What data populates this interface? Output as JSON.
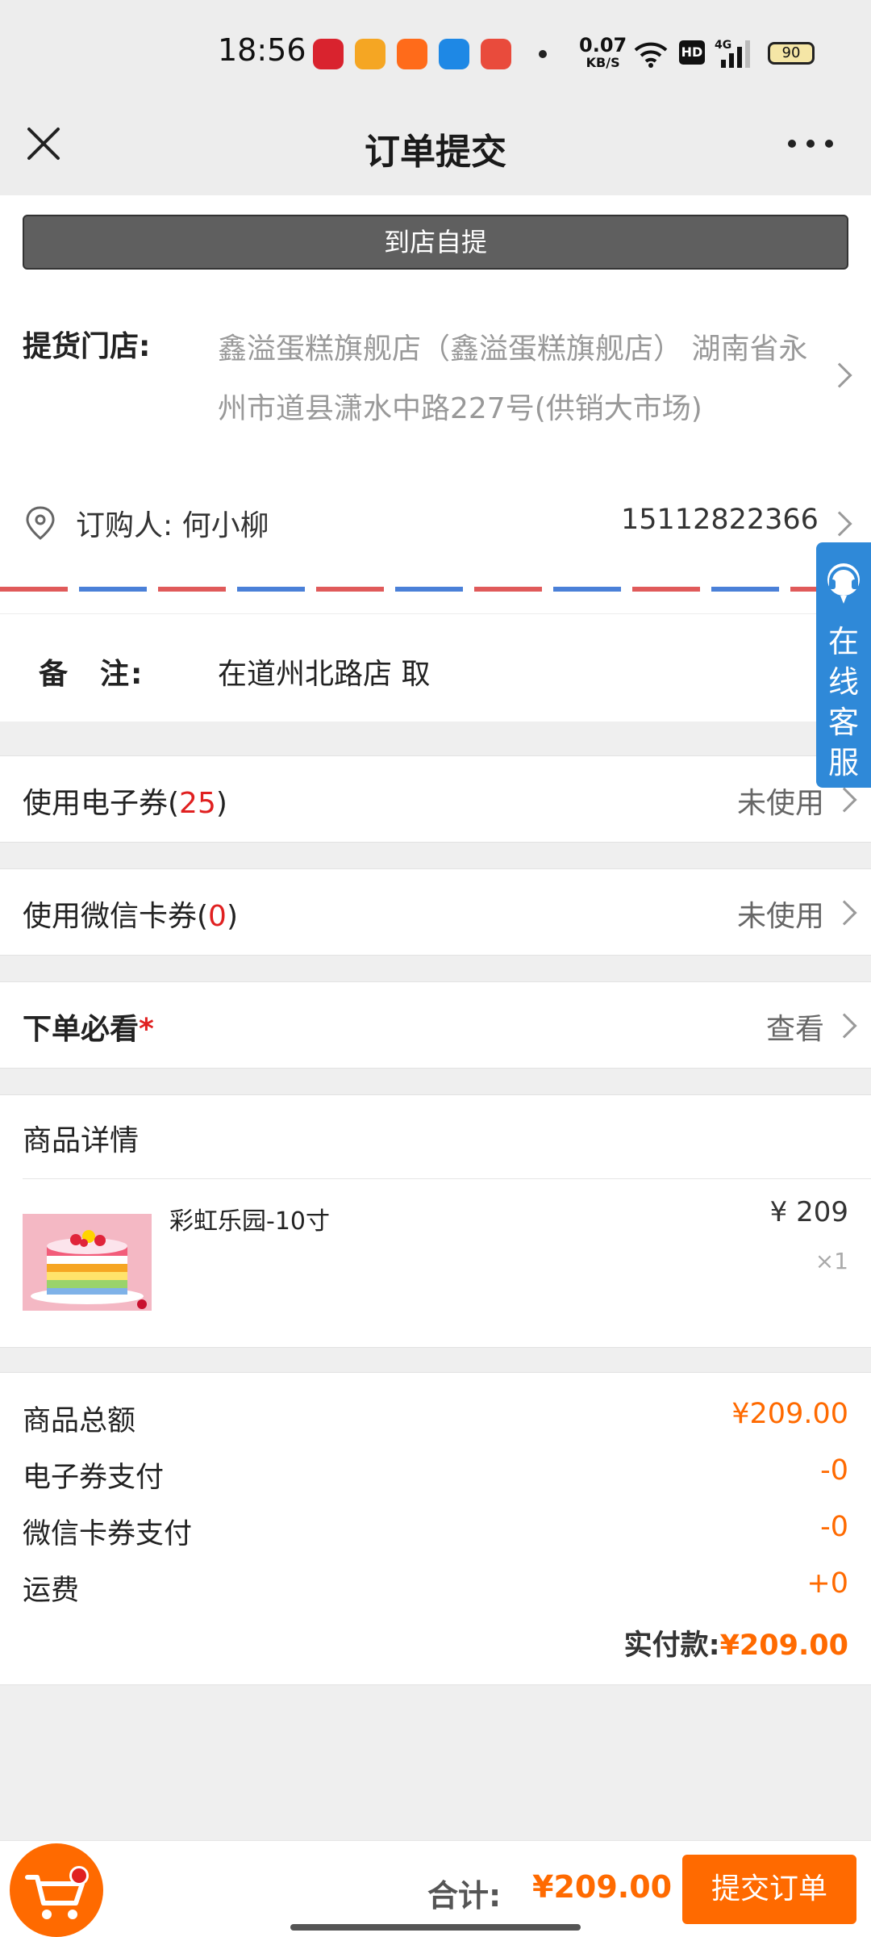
{
  "status_bar": {
    "time": "18:56",
    "net_speed_value": "0.07",
    "net_speed_unit": "KB/S",
    "battery": "90",
    "icons": [
      "citic-bank-icon",
      "weibo-icon",
      "app-orange-icon",
      "alipay-icon",
      "taobao-icon",
      "wifi-icon",
      "hd-icon",
      "signal-4g-icon",
      "battery-icon"
    ]
  },
  "header": {
    "title": "订单提交"
  },
  "delivery": {
    "mode_label": "到店自提"
  },
  "store": {
    "label": "提货门店:",
    "line1": "鑫溢蛋糕旗舰店（鑫溢蛋糕旗舰店） 湖南省永",
    "line2": "州市道县潇水中路227号(供销大市场)"
  },
  "buyer": {
    "label": "订购人: 何小柳",
    "phone": "15112822366"
  },
  "remark": {
    "label": "备　注:",
    "value": "在道州北路店 取"
  },
  "options": {
    "ecoupon": {
      "label_prefix": "使用电子券(",
      "count": "25",
      "label_suffix": ")",
      "value": "未使用"
    },
    "wxcard": {
      "label_prefix": "使用微信卡券(",
      "count": "0",
      "label_suffix": ")",
      "value": "未使用"
    },
    "must_read": {
      "label": "下单必看",
      "star": "*",
      "value": "查看"
    }
  },
  "product_section": {
    "title": "商品详情",
    "items": [
      {
        "name": "彩虹乐园-10寸",
        "price": "¥ 209",
        "qty": "×1"
      }
    ]
  },
  "summary": {
    "subtotal_label": "商品总额",
    "subtotal_value": "¥209.00",
    "ecoupon_label": "电子券支付",
    "ecoupon_value": "-0",
    "wxcard_label": "微信卡券支付",
    "wxcard_value": "-0",
    "shipping_label": "运费",
    "shipping_value": "+0",
    "paid_label": "实付款:",
    "paid_value": "¥209.00"
  },
  "customer_service": {
    "label": "在线客服"
  },
  "bottom_bar": {
    "total_label": "合计:",
    "total_value": "¥209.00",
    "submit_label": "提交订单"
  },
  "colors": {
    "accent": "#ff6a00",
    "danger": "#e02020",
    "cs_blue": "#2f89d8"
  }
}
